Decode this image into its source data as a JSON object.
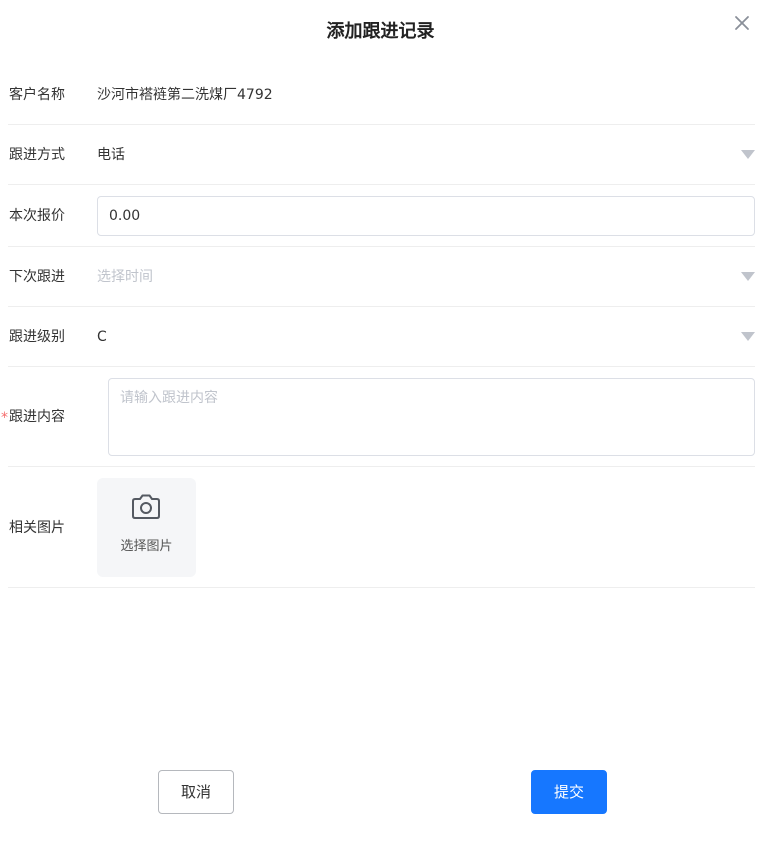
{
  "dialog": {
    "title": "添加跟进记录"
  },
  "form": {
    "customer": {
      "label": "客户名称",
      "value": "沙河市褡裢第二洗煤厂4792"
    },
    "method": {
      "label": "跟进方式",
      "value": "电话"
    },
    "quote": {
      "label": "本次报价",
      "value": "0.00"
    },
    "next_followup": {
      "label": "下次跟进",
      "placeholder": "选择时间"
    },
    "level": {
      "label": "跟进级别",
      "value": "C"
    },
    "content": {
      "label": "跟进内容",
      "required_mark": "*",
      "placeholder": "请输入跟进内容"
    },
    "images": {
      "label": "相关图片",
      "upload_text": "选择图片"
    }
  },
  "footer": {
    "cancel_label": "取消",
    "submit_label": "提交"
  },
  "colors": {
    "primary": "#1677ff",
    "required": "#f56c6c",
    "placeholder": "#c0c4cc",
    "divider": "#eeeeee"
  },
  "icons": {
    "close": "close-icon",
    "dropdown": "caret-down-icon",
    "camera": "camera-icon"
  }
}
